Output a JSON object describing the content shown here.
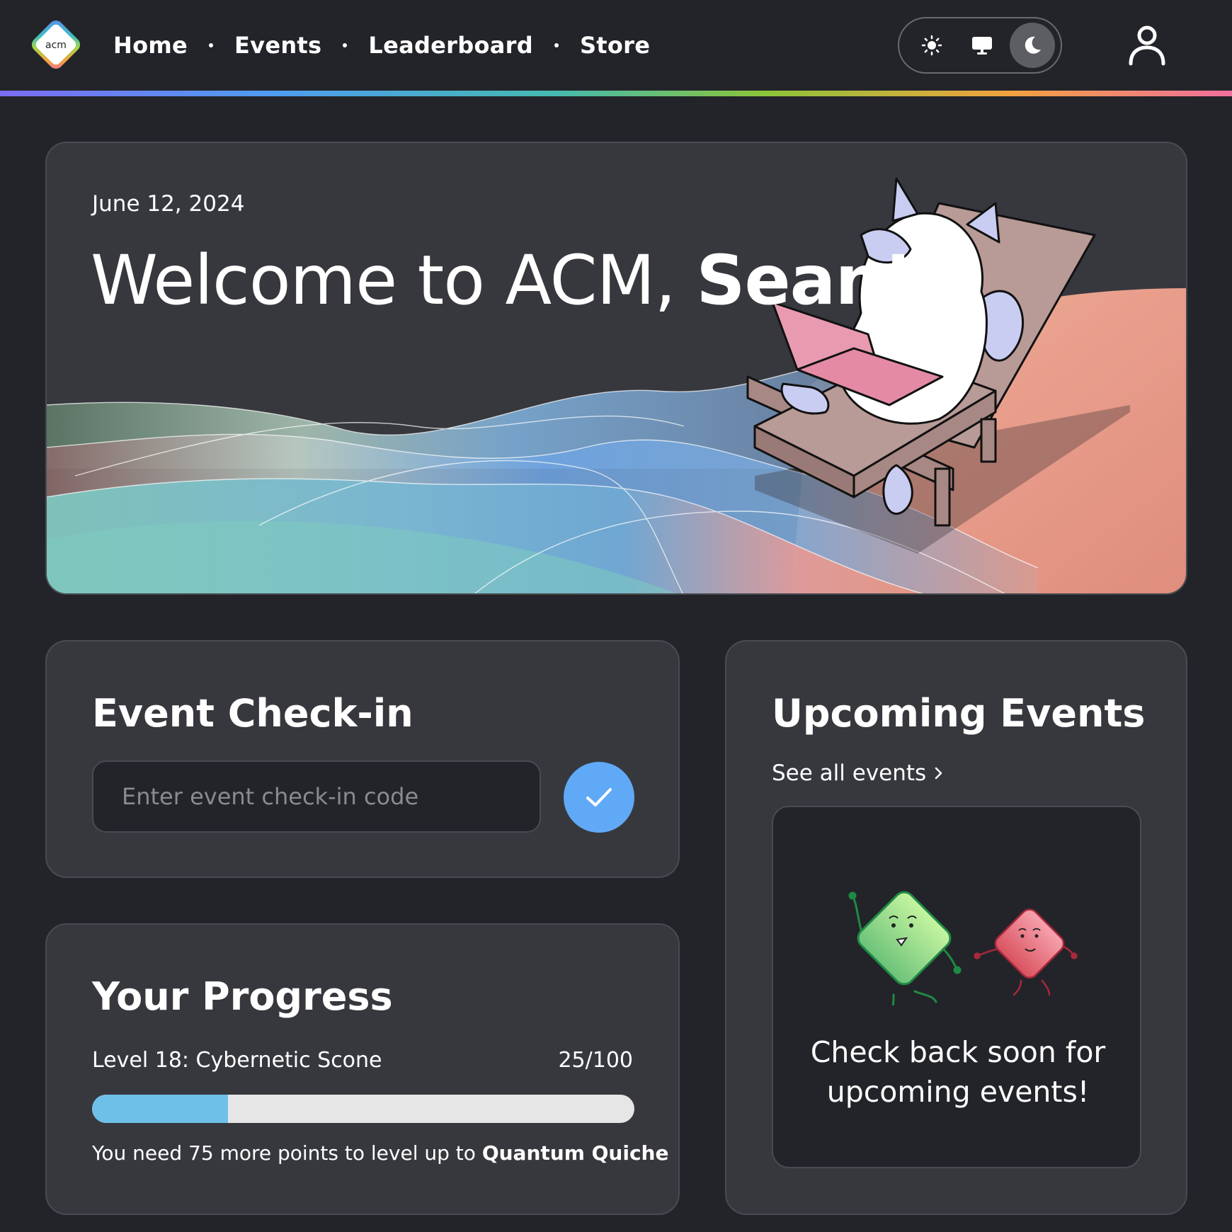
{
  "nav": {
    "logo_text": "acm",
    "links": [
      {
        "label": "Home"
      },
      {
        "label": "Events"
      },
      {
        "label": "Leaderboard"
      },
      {
        "label": "Store"
      }
    ],
    "theme_options": [
      "sun-icon",
      "monitor-icon",
      "moon-icon"
    ],
    "active_theme": "moon-icon",
    "user_icon": "user-icon"
  },
  "hero": {
    "date": "June 12, 2024",
    "welcome_prefix": "Welcome to ACM, ",
    "user_name": "Sean!"
  },
  "checkin": {
    "title": "Event Check-in",
    "placeholder": "Enter event check-in code",
    "submit_icon": "check-icon"
  },
  "progress": {
    "title": "Your Progress",
    "level_label": "Level 18: Cybernetic Scone",
    "points_text": "25/100",
    "points_fraction": 0.25,
    "note_prefix": "You need 75 more points to level up to ",
    "next_level": "Quantum Quiche"
  },
  "upcoming": {
    "title": "Upcoming Events",
    "see_all_label": "See all events",
    "empty_message": "Check back soon for upcoming events!"
  },
  "colors": {
    "background": "#232429",
    "card": "#37383e",
    "accent_blue": "#60a9f6",
    "progress_fill": "#6ec0e8"
  }
}
